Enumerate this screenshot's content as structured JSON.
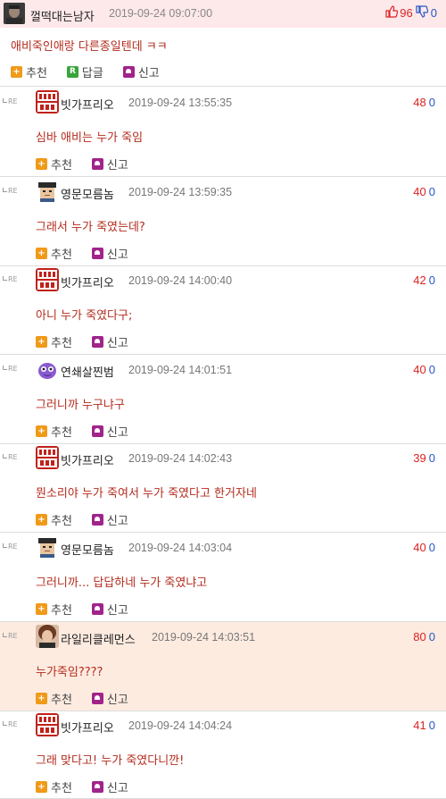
{
  "top_post": {
    "author": "껄떡대는남자",
    "date": "2019-09-24 09:07:00",
    "up": "96",
    "down": "0",
    "body": "애비죽인애랑 다른종일텐데 ㅋㅋ",
    "actions": {
      "recommend": "추천",
      "reply": "답글",
      "report": "신고"
    }
  },
  "re_label": "RE",
  "comment_actions": {
    "recommend": "추천",
    "report": "신고"
  },
  "comments": [
    {
      "author": "빗가프리오",
      "avatar": "text-logo",
      "date": "2019-09-24 13:55:35",
      "up": "48",
      "down": "0",
      "body": "심바 애비는 누가 죽임"
    },
    {
      "author": "영문모름놈",
      "avatar": "pixel-face",
      "date": "2019-09-24 13:59:35",
      "up": "40",
      "down": "0",
      "body": "그래서 누가 죽였는데?"
    },
    {
      "author": "빗가프리오",
      "avatar": "text-logo",
      "date": "2019-09-24 14:00:40",
      "up": "42",
      "down": "0",
      "body": "아니 누가 죽였다구;"
    },
    {
      "author": "연쇄살찐범",
      "avatar": "purple-blob",
      "date": "2019-09-24 14:01:51",
      "up": "40",
      "down": "0",
      "body": "그러니까 누구냐구"
    },
    {
      "author": "빗가프리오",
      "avatar": "text-logo",
      "date": "2019-09-24 14:02:43",
      "up": "39",
      "down": "0",
      "body": "뭔소리야 누가 죽여서 누가 죽였다고 한거자네"
    },
    {
      "author": "영문모름놈",
      "avatar": "pixel-face",
      "date": "2019-09-24 14:03:04",
      "up": "40",
      "down": "0",
      "body": "그러니까... 답답하네 누가 죽였냐고"
    },
    {
      "author": "라일리클레먼스",
      "avatar": "photo-face",
      "date": "2019-09-24 14:03:51",
      "up": "80",
      "down": "0",
      "body": "누가죽임????",
      "highlight": true
    },
    {
      "author": "빗가프리오",
      "avatar": "text-logo",
      "date": "2019-09-24 14:04:24",
      "up": "41",
      "down": "0",
      "body": "그래 맞다고! 누가 죽였다니깐!"
    }
  ],
  "colors": {
    "top_header_bg": "#fde8ea",
    "highlight_bg": "#fdebe0",
    "body_text": "#b42b1d",
    "up_vote": "#dd2222",
    "down_vote": "#2756c8",
    "recommend_icon": "#f09a19",
    "reply_icon": "#3aa33a",
    "report_icon": "#a0248a"
  },
  "icons": [
    "thumbs-up-icon",
    "thumbs-down-icon",
    "plus-icon",
    "reply-icon",
    "report-icon",
    "re-arrow-icon"
  ]
}
